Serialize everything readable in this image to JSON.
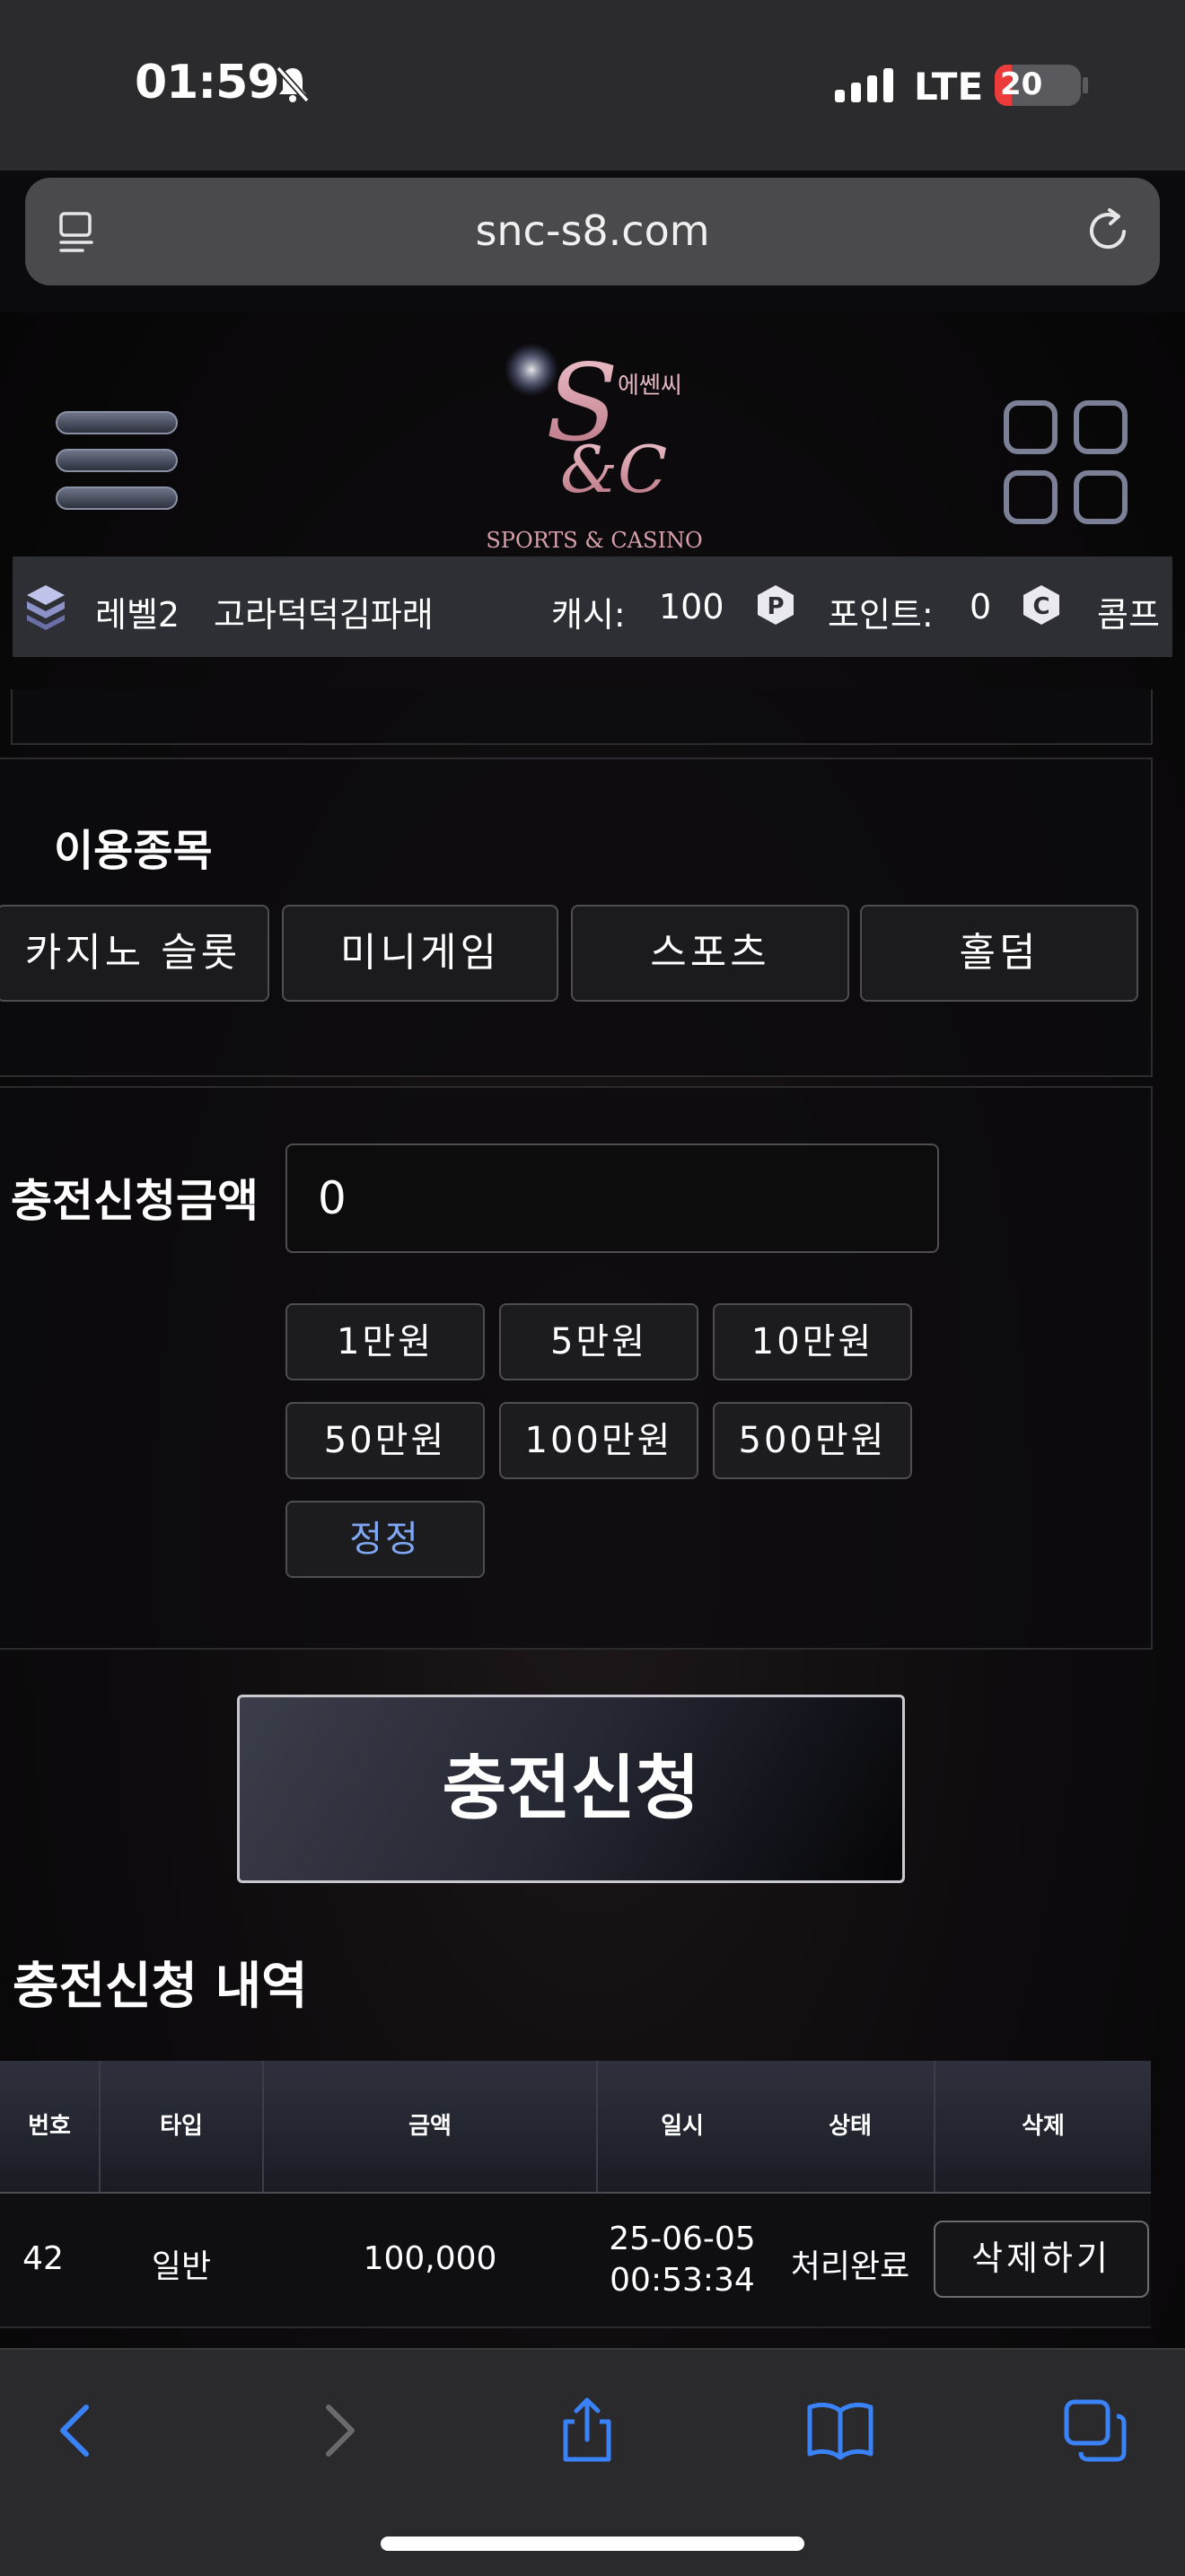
{
  "status_bar": {
    "time": "01:59",
    "network": "LTE",
    "battery_level": "20",
    "battery_fraction": 0.2
  },
  "browser": {
    "url": "snc-s8.com"
  },
  "header": {
    "logo_text_ko": "에쎈씨",
    "logo_text": "SPORTS & CASINO"
  },
  "user_bar": {
    "level": "레벨2",
    "username": "고라덕덕김파래",
    "cash_label": "캐시:",
    "cash_value": "100",
    "point_label": "포인트:",
    "point_value": "0",
    "comp_label": "콤프"
  },
  "games": {
    "title": "이용종목",
    "items": [
      "카지노 슬롯",
      "미니게임",
      "스포츠",
      "홀덤"
    ]
  },
  "deposit": {
    "label": "충전신청금액",
    "amount_value": "0",
    "quick_amounts": [
      "1만원",
      "5만원",
      "10만원",
      "50만원",
      "100만원",
      "500만원"
    ],
    "reset_label": "정정",
    "submit_label": "충전신청"
  },
  "history": {
    "title": "충전신청 내역",
    "columns": [
      "번호",
      "타입",
      "금액",
      "일시",
      "상태",
      "삭제"
    ],
    "rows": [
      {
        "no": "42",
        "type": "일반",
        "amount": "100,000",
        "date": "25-06-05",
        "time": "00:53:34",
        "status": "처리완료",
        "action": "삭제하기"
      }
    ]
  },
  "colors": {
    "accent_link": "#7fa6f2",
    "battery_red": "#eb3b3b",
    "safari_blue": "#3a82f7"
  }
}
